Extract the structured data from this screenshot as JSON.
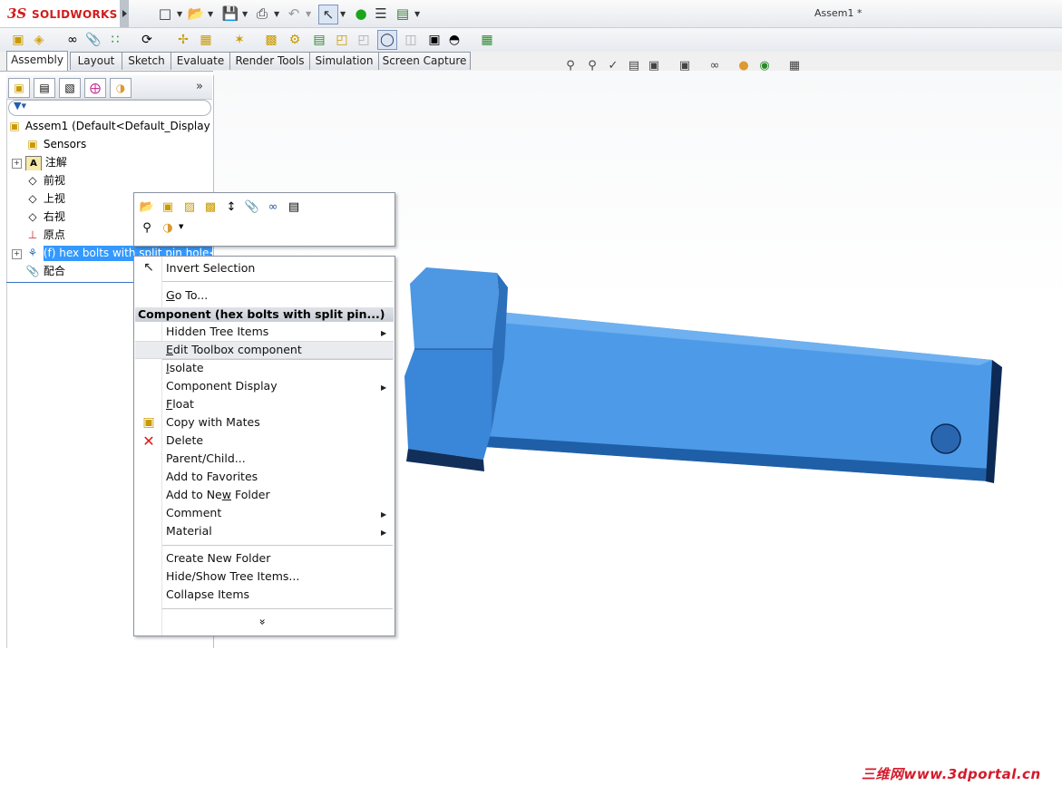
{
  "app": {
    "logo_prefix": "3S",
    "logo_name": "SOLIDWORKS",
    "document_title": "Assem1 *"
  },
  "quick_access": {
    "items": [
      "new-icon",
      "open-icon",
      "save-icon",
      "print-icon",
      "undo-icon",
      "select-icon",
      "rebuild-icon",
      "options-icon",
      "file-properties-icon"
    ]
  },
  "command_tabs": [
    "Assembly",
    "Layout",
    "Sketch",
    "Evaluate",
    "Render Tools",
    "Simulation",
    "Screen Capture"
  ],
  "active_tab": "Assembly",
  "feature_tree": {
    "root": "Assem1  (Default<Default_Display S",
    "items": [
      {
        "label": "Sensors",
        "icon": "sensors-folder-icon",
        "expandable": false
      },
      {
        "label": "注解",
        "icon": "annotations-icon",
        "expandable": true
      },
      {
        "label": "前视",
        "icon": "plane-icon",
        "expandable": false
      },
      {
        "label": "上视",
        "icon": "plane-icon",
        "expandable": false
      },
      {
        "label": "右视",
        "icon": "plane-icon",
        "expandable": false
      },
      {
        "label": "原点",
        "icon": "origin-icon",
        "expandable": false
      },
      {
        "label": "(f) hex bolts with split pin hole<",
        "icon": "toolbox-bolt-icon",
        "expandable": true,
        "selected": true
      },
      {
        "label": "配合",
        "icon": "mates-icon",
        "expandable": false
      }
    ]
  },
  "context_menu": {
    "header": "Component (hex bolts with split pin...)",
    "items_top": [
      {
        "label": "Invert Selection",
        "icon": "invert-selection-icon"
      },
      {
        "label": "Go To...",
        "u": "G",
        "rest": "o To..."
      }
    ],
    "items": [
      {
        "key": "hidden",
        "pre": "",
        "u": "",
        "rest": "Hidden Tree Items",
        "submenu": true
      },
      {
        "key": "edit-toolbox",
        "pre": "",
        "u": "E",
        "rest": "dit Toolbox component",
        "submenu": false,
        "highlight": true
      },
      {
        "key": "isolate",
        "pre": "",
        "u": "I",
        "rest": "solate",
        "submenu": false
      },
      {
        "key": "component-display",
        "pre": "",
        "u": "",
        "rest": "Component Display",
        "submenu": true
      },
      {
        "key": "float",
        "pre": "",
        "u": "F",
        "rest": "loat",
        "submenu": false
      },
      {
        "key": "copy-with-mates",
        "pre": "",
        "u": "",
        "rest": "Copy with Mates",
        "submenu": false,
        "icon": "copy-with-mates-icon"
      },
      {
        "key": "delete",
        "pre": "",
        "u": "",
        "rest": "Delete",
        "submenu": false,
        "icon": "delete-icon"
      },
      {
        "key": "parent-child",
        "pre": "",
        "u": "",
        "rest": "Parent/Child...",
        "submenu": false
      },
      {
        "key": "add-favorites",
        "pre": "",
        "u": "",
        "rest": "Add to Favorites",
        "submenu": false
      },
      {
        "key": "add-folder",
        "pre": "Add to Ne",
        "u": "w",
        "rest": " Folder",
        "submenu": false
      },
      {
        "key": "comment",
        "pre": "",
        "u": "",
        "rest": "Comment",
        "submenu": true
      },
      {
        "key": "material",
        "pre": "",
        "u": "",
        "rest": "Material",
        "submenu": true
      }
    ],
    "items_bottom": [
      "Create New Folder",
      "Hide/Show Tree Items...",
      "Collapse Items"
    ],
    "expand_glyph": "»"
  },
  "colors": {
    "part_blue": "#3c8fe6",
    "selection_blue": "#3399ff",
    "delete_red": "#e01919",
    "brand_red": "#d21b1b"
  },
  "watermark": "三维网www.3dportal.cn"
}
